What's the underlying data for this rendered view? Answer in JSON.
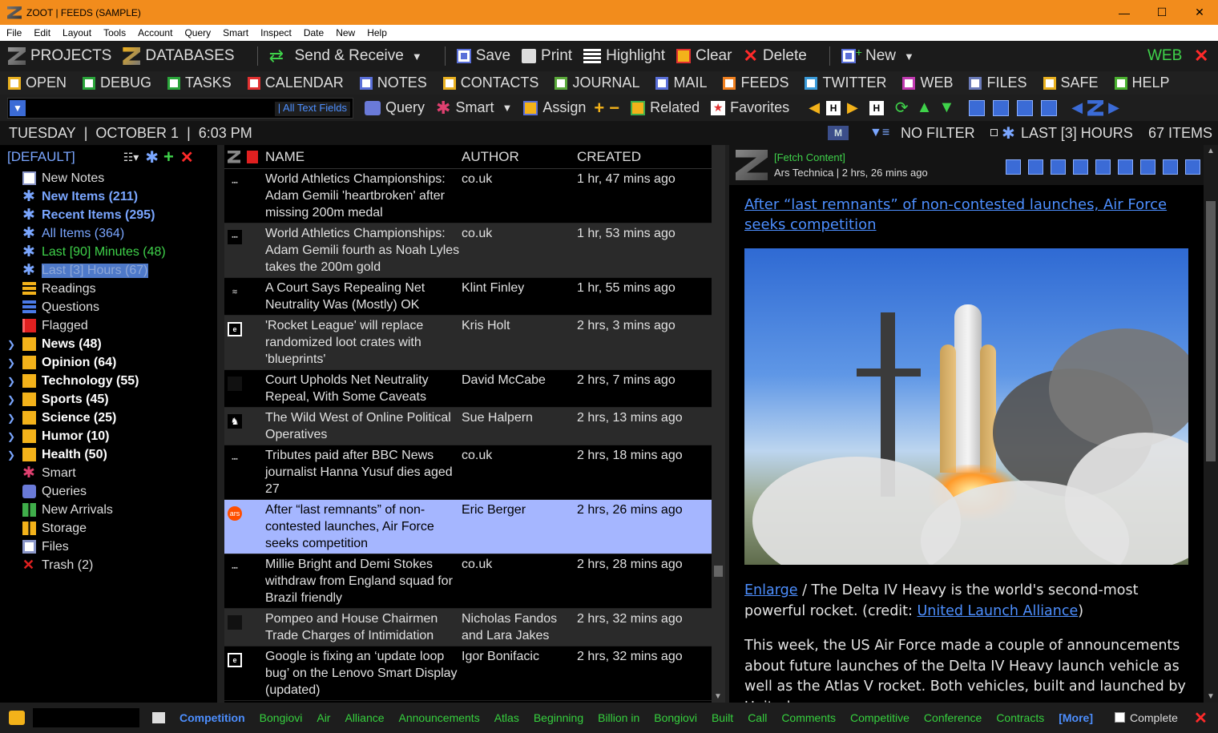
{
  "window": {
    "title": "ZOOT  |  FEEDS (SAMPLE)",
    "min": "—",
    "max": "☐",
    "close": "✕"
  },
  "menu": [
    "File",
    "Edit",
    "Layout",
    "Tools",
    "Account",
    "Query",
    "Smart",
    "Inspect",
    "Date",
    "New",
    "Help"
  ],
  "toolbar1": {
    "projects": "PROJECTS",
    "databases": "DATABASES",
    "send_receive": "Send & Receive",
    "save": "Save",
    "print": "Print",
    "highlight": "Highlight",
    "clear": "Clear",
    "delete": "Delete",
    "new": "New",
    "web": "WEB"
  },
  "toolbar2": [
    {
      "label": "OPEN",
      "color": "#e8b020"
    },
    {
      "label": "DEBUG",
      "color": "#2aa43a"
    },
    {
      "label": "TASKS",
      "color": "#2aa43a"
    },
    {
      "label": "CALENDAR",
      "color": "#e03030"
    },
    {
      "label": "NOTES",
      "color": "#5a6fd8"
    },
    {
      "label": "CONTACTS",
      "color": "#e8b020"
    },
    {
      "label": "JOURNAL",
      "color": "#5aa83a"
    },
    {
      "label": "MAIL",
      "color": "#5a6fd8"
    },
    {
      "label": "FEEDS",
      "color": "#f08020"
    },
    {
      "label": "TWITTER",
      "color": "#3a9ad8"
    },
    {
      "label": "WEB",
      "color": "#c03ab0"
    },
    {
      "label": "FILES",
      "color": "#6a7ab8"
    },
    {
      "label": "SAFE",
      "color": "#e8b020"
    },
    {
      "label": "HELP",
      "color": "#4ab030"
    }
  ],
  "toolbar3": {
    "search_scope": "| All Text Fields",
    "query": "Query",
    "smart": "Smart",
    "assign": "Assign",
    "assign_add": "+",
    "assign_remove": "−",
    "related": "Related",
    "favorites": "Favorites"
  },
  "datebar": {
    "day": "TUESDAY",
    "sep1": "|",
    "date": "OCTOBER 1",
    "sep2": "|",
    "time": "6:03 PM",
    "filter": "NO FILTER",
    "range": "LAST [3] HOURS",
    "count": "67 ITEMS"
  },
  "tree": {
    "header": "[DEFAULT]",
    "items": [
      {
        "label": "New Notes",
        "color": "#ffffff",
        "bold": false,
        "chev": false,
        "icon": "note",
        "text_color": "#dddddd"
      },
      {
        "label": "New Items (211)",
        "color": "#7aa6ff",
        "bold": true,
        "chev": false,
        "icon": "smart",
        "text_color": "#7aa6ff"
      },
      {
        "label": "Recent Items (295)",
        "color": "#7aa6ff",
        "bold": true,
        "chev": false,
        "icon": "smart",
        "text_color": "#7aa6ff"
      },
      {
        "label": "All Items (364)",
        "color": "#7aa6ff",
        "bold": false,
        "chev": false,
        "icon": "smart",
        "text_color": "#7aa6ff"
      },
      {
        "label": "Last [90] Minutes (48)",
        "color": "#7aa6ff",
        "bold": false,
        "chev": false,
        "icon": "smart",
        "text_color": "#3fd24a"
      },
      {
        "label": "Last [3] Hours (67)",
        "color": "#7aa6ff",
        "bold": false,
        "chev": false,
        "icon": "smart",
        "text_color": "#8fa8d8",
        "selected": true
      },
      {
        "label": "Readings",
        "color": "#f3b21a",
        "bold": false,
        "chev": false,
        "icon": "lines",
        "text_color": "#dddddd"
      },
      {
        "label": "Questions",
        "color": "#4a7ae8",
        "bold": false,
        "chev": false,
        "icon": "lines",
        "text_color": "#dddddd"
      },
      {
        "label": "Flagged",
        "color": "#e02020",
        "bold": false,
        "chev": false,
        "icon": "flag",
        "text_color": "#dddddd"
      },
      {
        "label": "News (48)",
        "color": "#f3b21a",
        "bold": true,
        "chev": true,
        "icon": "folder",
        "text_color": "#ffffff"
      },
      {
        "label": "Opinion (64)",
        "color": "#f3b21a",
        "bold": true,
        "chev": true,
        "icon": "folder",
        "text_color": "#ffffff"
      },
      {
        "label": "Technology (55)",
        "color": "#f3b21a",
        "bold": true,
        "chev": true,
        "icon": "folder",
        "text_color": "#ffffff"
      },
      {
        "label": "Sports (45)",
        "color": "#f3b21a",
        "bold": true,
        "chev": true,
        "icon": "folder",
        "text_color": "#ffffff"
      },
      {
        "label": "Science (25)",
        "color": "#f3b21a",
        "bold": true,
        "chev": true,
        "icon": "folder",
        "text_color": "#ffffff"
      },
      {
        "label": "Humor (10)",
        "color": "#f3b21a",
        "bold": true,
        "chev": true,
        "icon": "folder",
        "text_color": "#ffffff"
      },
      {
        "label": "Health (50)",
        "color": "#f3b21a",
        "bold": true,
        "chev": true,
        "icon": "folder",
        "text_color": "#ffffff"
      },
      {
        "label": "Smart",
        "color": "#e04070",
        "bold": false,
        "chev": false,
        "icon": "smart",
        "text_color": "#dddddd"
      },
      {
        "label": "Queries",
        "color": "#6a7ad8",
        "bold": false,
        "chev": false,
        "icon": "binoc",
        "text_color": "#dddddd"
      },
      {
        "label": "New Arrivals",
        "color": "#3fae4a",
        "bold": false,
        "chev": false,
        "icon": "grid",
        "text_color": "#dddddd"
      },
      {
        "label": "Storage",
        "color": "#f3b21a",
        "bold": false,
        "chev": false,
        "icon": "grid",
        "text_color": "#dddddd"
      },
      {
        "label": "Files",
        "color": "#8a96c8",
        "bold": false,
        "chev": false,
        "icon": "file",
        "text_color": "#dddddd"
      },
      {
        "label": "Trash (2)",
        "color": "#e02020",
        "bold": false,
        "chev": false,
        "icon": "x",
        "text_color": "#dddddd"
      }
    ]
  },
  "list": {
    "columns": {
      "name": "NAME",
      "author": "AUTHOR",
      "created": "CREATED"
    },
    "rows": [
      {
        "favicon": "BBC",
        "name": "World Athletics Championships: Adam Gemili 'heartbroken' after missing 200m medal",
        "author": "co.uk",
        "created": "1 hr, 47 mins ago"
      },
      {
        "favicon": "BBC",
        "name": "World Athletics Championships: Adam Gemili fourth as Noah Lyles takes the 200m gold",
        "author": "co.uk",
        "created": "1 hr, 53 mins ago"
      },
      {
        "favicon": "W",
        "name": "A Court Says Repealing Net Neutrality Was (Mostly) OK",
        "author": "Klint Finley",
        "created": "1 hr, 55 mins ago"
      },
      {
        "favicon": "E",
        "name": "'Rocket League' will replace randomized loot crates with 'blueprints'",
        "author": "Kris Holt",
        "created": "2 hrs, 3 mins ago"
      },
      {
        "favicon": "",
        "name": "Court Upholds Net Neutrality Repeal, With Some Caveats",
        "author": "David McCabe",
        "created": "2 hrs, 7 mins ago"
      },
      {
        "favicon": "NY",
        "name": "The Wild West of Online Political Operatives",
        "author": "Sue Halpern",
        "created": "2 hrs, 13 mins ago"
      },
      {
        "favicon": "BBC",
        "name": "Tributes paid after BBC News journalist Hanna Yusuf dies aged 27",
        "author": "co.uk",
        "created": "2 hrs, 18 mins ago"
      },
      {
        "favicon": "ars",
        "name": "After “last remnants” of non-contested launches, Air Force seeks competition",
        "author": "Eric Berger",
        "created": "2 hrs, 26 mins ago",
        "selected": true
      },
      {
        "favicon": "BBC",
        "name": "Millie Bright and Demi Stokes withdraw from England squad for Brazil friendly",
        "author": "co.uk",
        "created": "2 hrs, 28 mins ago"
      },
      {
        "favicon": "",
        "name": "Pompeo and House Chairmen Trade Charges of Intimidation",
        "author": "Nicholas Fandos and Lara Jakes",
        "created": "2 hrs, 32 mins ago"
      },
      {
        "favicon": "E",
        "name": "Google is fixing an ‘update loop bug’ on the Lenovo Smart Display (updated)",
        "author": "Igor Bonifacic",
        "created": "2 hrs, 32 mins ago"
      }
    ]
  },
  "reader": {
    "fetch": "[Fetch Content]",
    "source": "Ars Technica | 2 hrs, 26 mins ago",
    "title": "After “last remnants” of non-contested launches, Air Force seeks competition",
    "caption_link": "Enlarge",
    "caption_text": " / The Delta IV Heavy is the world's second-most powerful rocket. (credit: ",
    "caption_credit": "United Launch Alliance",
    "caption_end": ")",
    "body": "This week, the US Air Force made a couple of announcements about future launches of the Delta IV Heavy launch vehicle as well as the Atlas V rocket. Both vehicles, built and launched by United"
  },
  "statusbar": {
    "keyword_active": "Competition",
    "keywords": [
      "Bongiovi",
      "Air",
      "Alliance",
      "Announcements",
      "Atlas",
      "Beginning",
      "Billion in",
      "Bongiovi",
      "Built",
      "Call",
      "Comments",
      "Competitive",
      "Conference",
      "Contracts"
    ],
    "more": "[More]",
    "complete": "Complete"
  }
}
